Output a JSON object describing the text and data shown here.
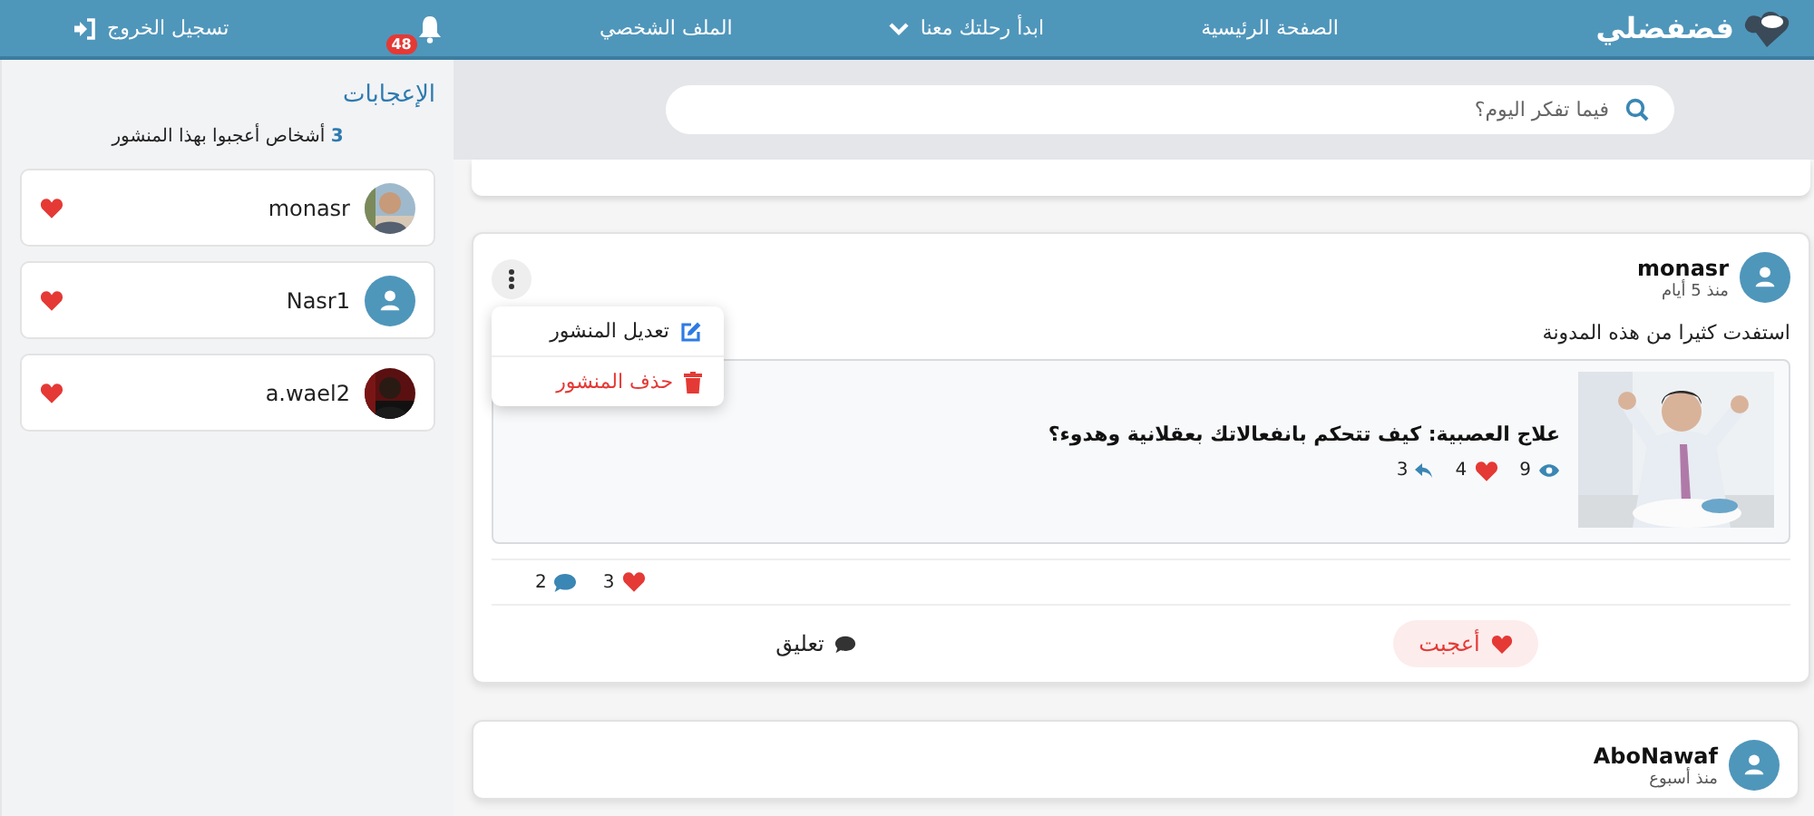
{
  "navbar": {
    "logo": "فضفضلي",
    "links": [
      {
        "kind": "link",
        "label": "الصفحة الرئيسية"
      },
      {
        "kind": "dropdown",
        "label": "ابدأ رحلتك معنا"
      },
      {
        "kind": "link",
        "label": "الملف الشخصي"
      },
      {
        "kind": "notifications",
        "badge": "48"
      },
      {
        "kind": "logout",
        "label": "تسجيل الخروج"
      }
    ]
  },
  "likes_panel": {
    "title": "الإعجابات",
    "count": "3",
    "summary": "أشخاص أعجبوا بهذا المنشور",
    "users": [
      {
        "name": "monasr"
      },
      {
        "name": "Nasr1",
        "kind": "default"
      },
      {
        "name": "a.wael2"
      }
    ]
  },
  "search": {
    "placeholder": "فيما تفكر اليوم؟"
  },
  "posts": [
    {
      "author": "monasr",
      "time": "منذ 5 أيام",
      "menu": [
        {
          "kind": "edit",
          "label": "تعديل المنشور"
        },
        {
          "kind": "delete",
          "label": "حذف المنشور"
        }
      ],
      "text": "استفدت كثيرا من هذه المدونة",
      "shared": {
        "title": "علاج العصبية: كيف تتحكم بانفعالاتك بعقلانية وهدوء؟",
        "views": "9",
        "likes": "4",
        "shares": "3"
      },
      "likes_count": "3",
      "comments_count": "2",
      "actions": [
        {
          "kind": "like",
          "label": "أعجبت",
          "selected": true
        },
        {
          "kind": "comment",
          "label": "تعليق",
          "selected": false
        }
      ]
    },
    {
      "author": "AboNawaf",
      "time": "منذ أسبوع"
    }
  ]
}
